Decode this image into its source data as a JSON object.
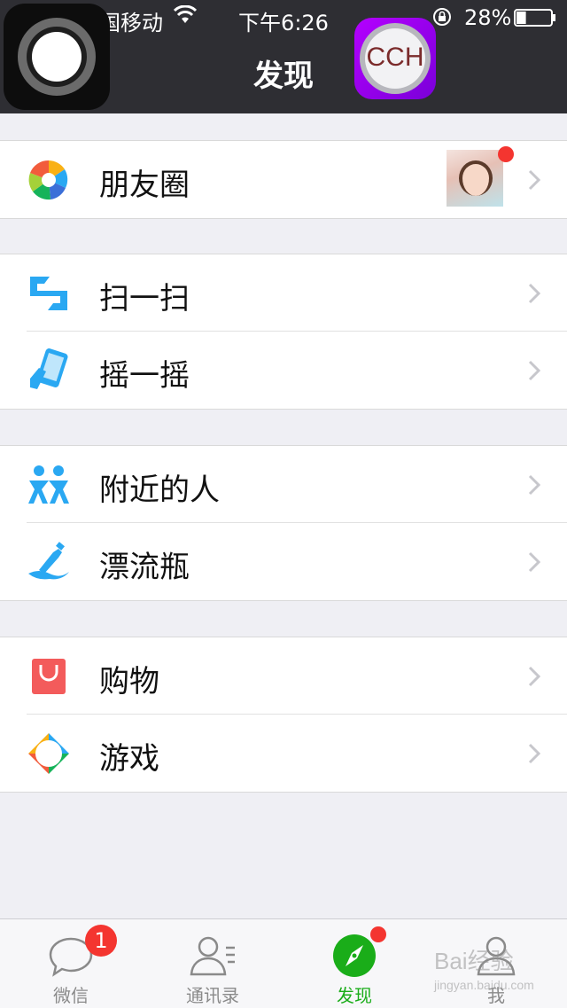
{
  "status_bar": {
    "carrier": "国移动",
    "time": "下午6:26",
    "battery": "28%",
    "battery_level": 0.28
  },
  "nav": {
    "title": "发现"
  },
  "overlay_app": {
    "label": "CCH"
  },
  "sections": [
    {
      "items": [
        {
          "label": "朋友圈",
          "icon": "moments-aperture-icon"
        }
      ]
    },
    {
      "items": [
        {
          "label": "扫一扫",
          "icon": "scan-icon"
        },
        {
          "label": "摇一摇",
          "icon": "shake-icon"
        }
      ]
    },
    {
      "items": [
        {
          "label": "附近的人",
          "icon": "people-nearby-icon"
        },
        {
          "label": "漂流瓶",
          "icon": "drift-bottle-icon"
        }
      ]
    },
    {
      "items": [
        {
          "label": "购物",
          "icon": "shopping-bag-icon"
        },
        {
          "label": "游戏",
          "icon": "games-icon"
        }
      ]
    }
  ],
  "tabs": [
    {
      "label": "微信",
      "badge": "1"
    },
    {
      "label": "通讯录"
    },
    {
      "label": "发现",
      "active": true
    },
    {
      "label": "我"
    }
  ],
  "colors": {
    "accent": "#1aad19",
    "badge": "#f43530",
    "navbar": "#2e2e33"
  },
  "watermark": {
    "text": "Bai经验",
    "sub": "jingyan.baidu.com"
  }
}
